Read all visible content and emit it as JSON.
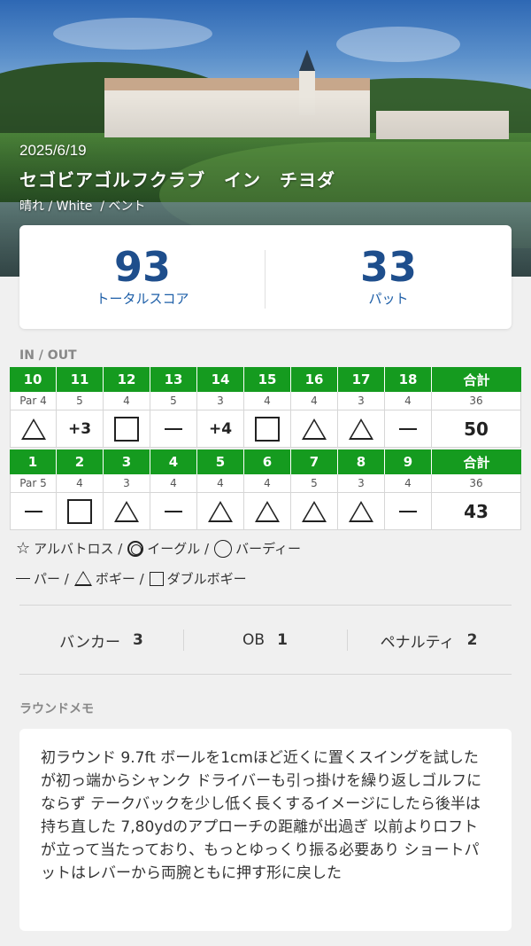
{
  "round": {
    "date": "2025/6/19",
    "course_name": "セゴビアゴルフクラブ　イン　チヨダ",
    "conditions": "晴れ / White  / ベント"
  },
  "summary": {
    "total_score": "93",
    "total_label": "トータルスコア",
    "putts": "33",
    "putts_label": "パット"
  },
  "scorecard": {
    "title": "IN / OUT",
    "total_label": "合計",
    "in": {
      "holes": [
        "10",
        "11",
        "12",
        "13",
        "14",
        "15",
        "16",
        "17",
        "18"
      ],
      "pars": [
        "Par 4",
        "5",
        "4",
        "5",
        "3",
        "4",
        "4",
        "3",
        "4"
      ],
      "par_total": "36",
      "results": [
        "triangle",
        "+3",
        "square",
        "dash",
        "+4",
        "square",
        "triangle",
        "triangle",
        "dash"
      ],
      "score_total": "50"
    },
    "out": {
      "holes": [
        "1",
        "2",
        "3",
        "4",
        "5",
        "6",
        "7",
        "8",
        "9"
      ],
      "pars": [
        "Par 5",
        "4",
        "3",
        "4",
        "4",
        "4",
        "5",
        "3",
        "4"
      ],
      "par_total": "36",
      "results": [
        "dash",
        "square",
        "triangle",
        "dash",
        "triangle",
        "triangle",
        "triangle",
        "triangle",
        "dash"
      ],
      "score_total": "43"
    }
  },
  "legend": {
    "albatross": "アルバトロス /",
    "eagle": "イーグル /",
    "birdie": "バーディー",
    "par": "パー /",
    "bogey": "ボギー /",
    "double_bogey": "ダブルボギー"
  },
  "stats": {
    "bunker_label": "バンカー",
    "bunker_value": "3",
    "ob_label": "OB",
    "ob_value": "1",
    "penalty_label": "ペナルティ",
    "penalty_value": "2"
  },
  "memo": {
    "title": "ラウンドメモ",
    "text": "初ラウンド 9.7ft ボールを1cmほど近くに置くスイングを試したが初っ端からシャンク ドライバーも引っ掛けを繰り返しゴルフにならず テークバックを少し低く長くするイメージにしたら後半は持ち直した 7,80ydのアプローチの距離が出過ぎ 以前よりロフトが立って当たっており、もっとゆっくり振る必要あり ショートパットはレバーから両腕ともに押す形に戻した"
  },
  "colors": {
    "accent_green": "#159b1f",
    "score_blue": "#1e4e8c"
  }
}
